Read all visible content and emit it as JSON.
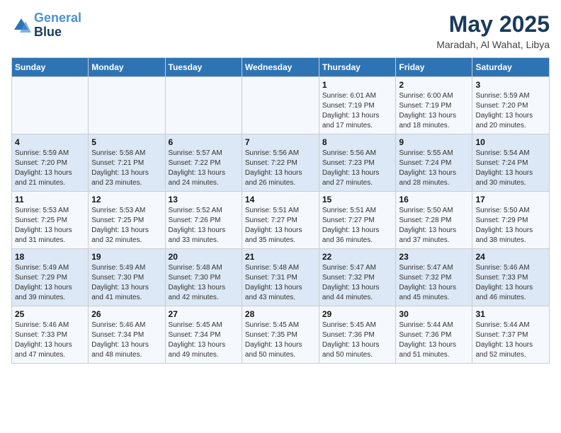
{
  "logo": {
    "line1": "General",
    "line2": "Blue"
  },
  "title": "May 2025",
  "location": "Maradah, Al Wahat, Libya",
  "days_of_week": [
    "Sunday",
    "Monday",
    "Tuesday",
    "Wednesday",
    "Thursday",
    "Friday",
    "Saturday"
  ],
  "weeks": [
    [
      {
        "day": "",
        "info": ""
      },
      {
        "day": "",
        "info": ""
      },
      {
        "day": "",
        "info": ""
      },
      {
        "day": "",
        "info": ""
      },
      {
        "day": "1",
        "info": "Sunrise: 6:01 AM\nSunset: 7:19 PM\nDaylight: 13 hours\nand 17 minutes."
      },
      {
        "day": "2",
        "info": "Sunrise: 6:00 AM\nSunset: 7:19 PM\nDaylight: 13 hours\nand 18 minutes."
      },
      {
        "day": "3",
        "info": "Sunrise: 5:59 AM\nSunset: 7:20 PM\nDaylight: 13 hours\nand 20 minutes."
      }
    ],
    [
      {
        "day": "4",
        "info": "Sunrise: 5:59 AM\nSunset: 7:20 PM\nDaylight: 13 hours\nand 21 minutes."
      },
      {
        "day": "5",
        "info": "Sunrise: 5:58 AM\nSunset: 7:21 PM\nDaylight: 13 hours\nand 23 minutes."
      },
      {
        "day": "6",
        "info": "Sunrise: 5:57 AM\nSunset: 7:22 PM\nDaylight: 13 hours\nand 24 minutes."
      },
      {
        "day": "7",
        "info": "Sunrise: 5:56 AM\nSunset: 7:22 PM\nDaylight: 13 hours\nand 26 minutes."
      },
      {
        "day": "8",
        "info": "Sunrise: 5:56 AM\nSunset: 7:23 PM\nDaylight: 13 hours\nand 27 minutes."
      },
      {
        "day": "9",
        "info": "Sunrise: 5:55 AM\nSunset: 7:24 PM\nDaylight: 13 hours\nand 28 minutes."
      },
      {
        "day": "10",
        "info": "Sunrise: 5:54 AM\nSunset: 7:24 PM\nDaylight: 13 hours\nand 30 minutes."
      }
    ],
    [
      {
        "day": "11",
        "info": "Sunrise: 5:53 AM\nSunset: 7:25 PM\nDaylight: 13 hours\nand 31 minutes."
      },
      {
        "day": "12",
        "info": "Sunrise: 5:53 AM\nSunset: 7:25 PM\nDaylight: 13 hours\nand 32 minutes."
      },
      {
        "day": "13",
        "info": "Sunrise: 5:52 AM\nSunset: 7:26 PM\nDaylight: 13 hours\nand 33 minutes."
      },
      {
        "day": "14",
        "info": "Sunrise: 5:51 AM\nSunset: 7:27 PM\nDaylight: 13 hours\nand 35 minutes."
      },
      {
        "day": "15",
        "info": "Sunrise: 5:51 AM\nSunset: 7:27 PM\nDaylight: 13 hours\nand 36 minutes."
      },
      {
        "day": "16",
        "info": "Sunrise: 5:50 AM\nSunset: 7:28 PM\nDaylight: 13 hours\nand 37 minutes."
      },
      {
        "day": "17",
        "info": "Sunrise: 5:50 AM\nSunset: 7:29 PM\nDaylight: 13 hours\nand 38 minutes."
      }
    ],
    [
      {
        "day": "18",
        "info": "Sunrise: 5:49 AM\nSunset: 7:29 PM\nDaylight: 13 hours\nand 39 minutes."
      },
      {
        "day": "19",
        "info": "Sunrise: 5:49 AM\nSunset: 7:30 PM\nDaylight: 13 hours\nand 41 minutes."
      },
      {
        "day": "20",
        "info": "Sunrise: 5:48 AM\nSunset: 7:30 PM\nDaylight: 13 hours\nand 42 minutes."
      },
      {
        "day": "21",
        "info": "Sunrise: 5:48 AM\nSunset: 7:31 PM\nDaylight: 13 hours\nand 43 minutes."
      },
      {
        "day": "22",
        "info": "Sunrise: 5:47 AM\nSunset: 7:32 PM\nDaylight: 13 hours\nand 44 minutes."
      },
      {
        "day": "23",
        "info": "Sunrise: 5:47 AM\nSunset: 7:32 PM\nDaylight: 13 hours\nand 45 minutes."
      },
      {
        "day": "24",
        "info": "Sunrise: 5:46 AM\nSunset: 7:33 PM\nDaylight: 13 hours\nand 46 minutes."
      }
    ],
    [
      {
        "day": "25",
        "info": "Sunrise: 5:46 AM\nSunset: 7:33 PM\nDaylight: 13 hours\nand 47 minutes."
      },
      {
        "day": "26",
        "info": "Sunrise: 5:46 AM\nSunset: 7:34 PM\nDaylight: 13 hours\nand 48 minutes."
      },
      {
        "day": "27",
        "info": "Sunrise: 5:45 AM\nSunset: 7:34 PM\nDaylight: 13 hours\nand 49 minutes."
      },
      {
        "day": "28",
        "info": "Sunrise: 5:45 AM\nSunset: 7:35 PM\nDaylight: 13 hours\nand 50 minutes."
      },
      {
        "day": "29",
        "info": "Sunrise: 5:45 AM\nSunset: 7:36 PM\nDaylight: 13 hours\nand 50 minutes."
      },
      {
        "day": "30",
        "info": "Sunrise: 5:44 AM\nSunset: 7:36 PM\nDaylight: 13 hours\nand 51 minutes."
      },
      {
        "day": "31",
        "info": "Sunrise: 5:44 AM\nSunset: 7:37 PM\nDaylight: 13 hours\nand 52 minutes."
      }
    ]
  ]
}
